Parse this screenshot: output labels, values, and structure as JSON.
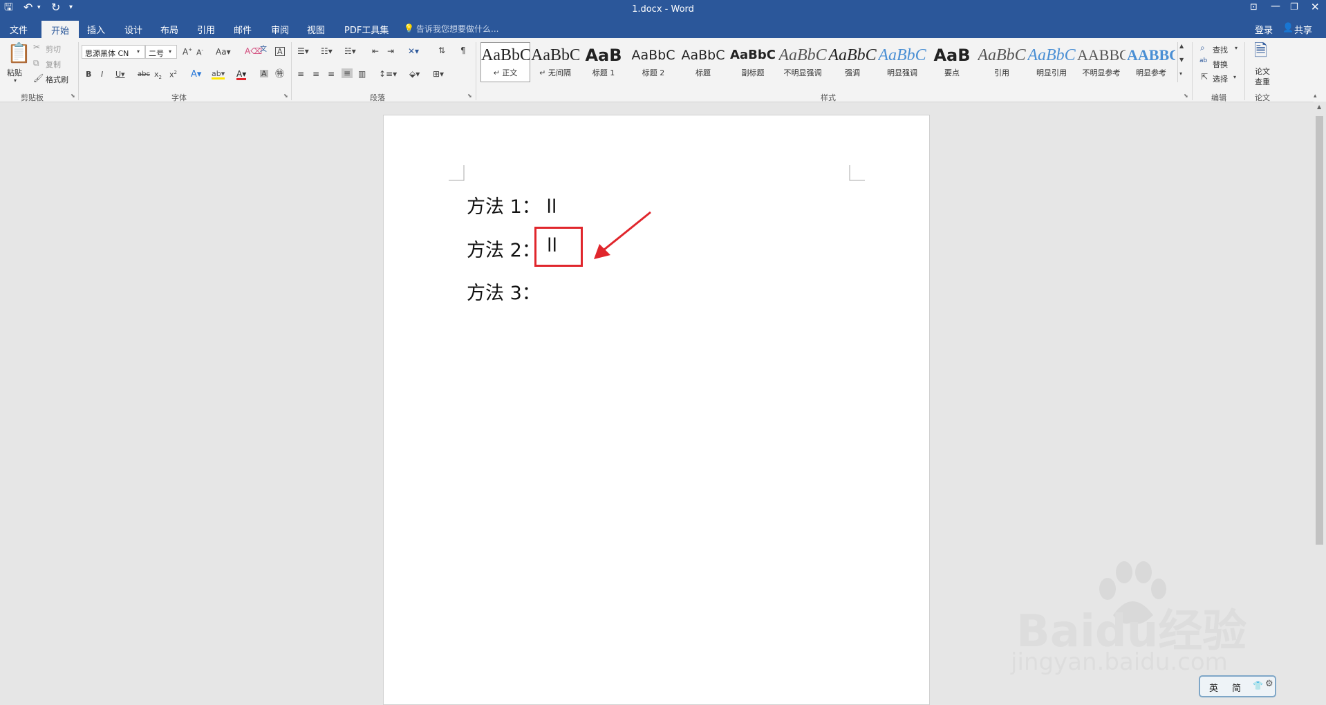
{
  "title_bar": {
    "doc_title": "1.docx - Word"
  },
  "tabs": [
    "文件",
    "开始",
    "插入",
    "设计",
    "布局",
    "引用",
    "邮件",
    "审阅",
    "视图",
    "PDF工具集"
  ],
  "tell_me": "告诉我您想要做什么...",
  "account": {
    "login": "登录",
    "share": "共享"
  },
  "ribbon": {
    "clipboard": {
      "paste": "粘贴",
      "cut": "剪切",
      "copy": "复制",
      "format_painter": "格式刷",
      "label": "剪贴板"
    },
    "font": {
      "font_name": "思源黑体 CN",
      "font_size": "二号",
      "label": "字体"
    },
    "paragraph": {
      "label": "段落"
    },
    "styles": {
      "items": [
        {
          "preview": "AaBbC",
          "name": "↵ 正文"
        },
        {
          "preview": "AaBbC",
          "name": "↵ 无间隔"
        },
        {
          "preview": "AaB",
          "name": "标题 1"
        },
        {
          "preview": "AaBbC",
          "name": "标题 2"
        },
        {
          "preview": "AaBbC",
          "name": "标题"
        },
        {
          "preview": "AaBbC",
          "name": "副标题"
        },
        {
          "preview": "AaBbC",
          "name": "不明显强调"
        },
        {
          "preview": "AaBbC",
          "name": "强调"
        },
        {
          "preview": "AaBbC",
          "name": "明显强调"
        },
        {
          "preview": "AaB",
          "name": "要点"
        },
        {
          "preview": "AaBbC",
          "name": "引用"
        },
        {
          "preview": "AaBbC",
          "name": "明显引用"
        },
        {
          "preview": "AABBC",
          "name": "不明显参考"
        },
        {
          "preview": "AABBC",
          "name": "明显参考"
        }
      ],
      "label": "样式"
    },
    "editing": {
      "find": "查找",
      "replace": "替换",
      "select": "选择",
      "label": "编辑"
    },
    "paper": {
      "check_line1": "论文",
      "check_line2": "查重",
      "label": "论文"
    }
  },
  "document": {
    "lines": [
      "方法 1：  ll",
      "方法 2：",
      "方法 3："
    ],
    "highlight_text": "ll"
  },
  "ime": {
    "lang": "英",
    "mode": "简"
  },
  "watermark": {
    "brand": "Baidu经验",
    "url": "jingyan.baidu.com"
  },
  "colors": {
    "accent": "#2b579a",
    "annotation": "#e0262c"
  }
}
